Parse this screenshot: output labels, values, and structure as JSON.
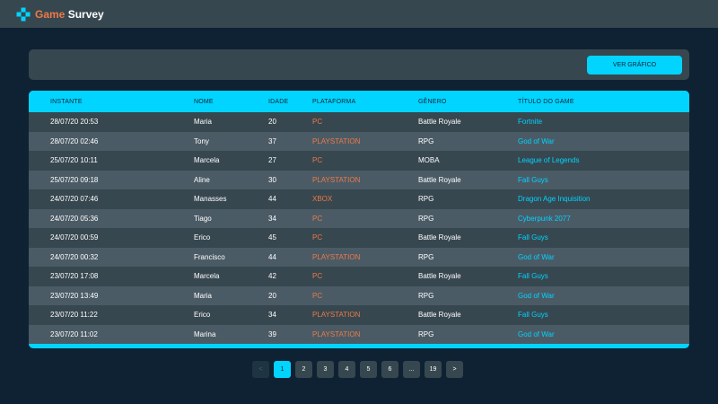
{
  "brand": {
    "part1": "Game",
    "part2": " Survey"
  },
  "toolbar": {
    "chart_button": "VER GRÁFICO"
  },
  "table": {
    "headers": [
      "INSTANTE",
      "NOME",
      "IDADE",
      "PLATAFORMA",
      "GÊNERO",
      "TÍTULO DO GAME"
    ],
    "rows": [
      [
        "28/07/20 20:53",
        "Maria",
        "20",
        "PC",
        "Battle Royale",
        "Fortnite"
      ],
      [
        "28/07/20 02:46",
        "Tony",
        "37",
        "PLAYSTATION",
        "RPG",
        "God of War"
      ],
      [
        "25/07/20 10:11",
        "Marcela",
        "27",
        "PC",
        "MOBA",
        "League of Legends"
      ],
      [
        "25/07/20 09:18",
        "Aline",
        "30",
        "PLAYSTATION",
        "Battle Royale",
        "Fall Guys"
      ],
      [
        "24/07/20 07:46",
        "Manasses",
        "44",
        "XBOX",
        "RPG",
        "Dragon Age Inquisition"
      ],
      [
        "24/07/20 05:36",
        "Tiago",
        "34",
        "PC",
        "RPG",
        "Cyberpunk 2077"
      ],
      [
        "24/07/20 00:59",
        "Erico",
        "45",
        "PC",
        "Battle Royale",
        "Fall Guys"
      ],
      [
        "24/07/20 00:32",
        "Francisco",
        "44",
        "PLAYSTATION",
        "RPG",
        "God of War"
      ],
      [
        "23/07/20 17:08",
        "Marcela",
        "42",
        "PC",
        "Battle Royale",
        "Fall Guys"
      ],
      [
        "23/07/20 13:49",
        "Maria",
        "20",
        "PC",
        "RPG",
        "God of War"
      ],
      [
        "23/07/20 11:22",
        "Erico",
        "34",
        "PLAYSTATION",
        "Battle Royale",
        "Fall Guys"
      ],
      [
        "23/07/20 11:02",
        "Marina",
        "39",
        "PLAYSTATION",
        "RPG",
        "God of War"
      ]
    ]
  },
  "pagination": {
    "prev": "<",
    "pages": [
      "1",
      "2",
      "3",
      "4",
      "5",
      "6",
      "...",
      "19"
    ],
    "next": ">",
    "current": "1"
  },
  "colors": {
    "accent": "#00d4ff",
    "brand_orange": "#ed7947",
    "background": "#0f2233",
    "panel": "#37474f"
  }
}
